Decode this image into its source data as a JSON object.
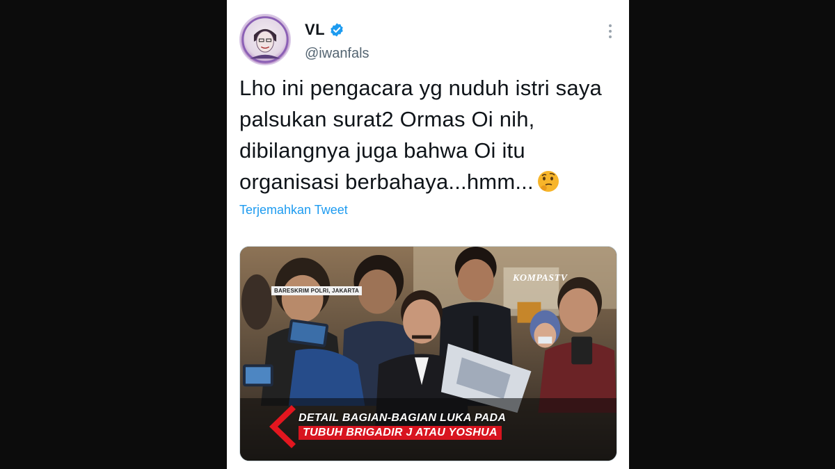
{
  "tweet": {
    "display_name": "VL",
    "handle": "@iwanfals",
    "verified": true,
    "text": "Lho ini pengacara yg nuduh istri saya palsukan surat2 Ormas Oi nih, dibilangnya juga bahwa Oi itu organisasi berbahaya...hmm...",
    "emoji": "thinking-face",
    "translate_label": "Terjemahkan Tweet"
  },
  "media": {
    "channel_logo": "KOMPASTV",
    "location_tag": "BARESKRIM POLRI, JAKARTA",
    "headline_line1": "DETAIL BAGIAN-BAGIAN LUKA PADA",
    "headline_line2": "TUBUH BRIGADIR J ATAU YOSHUA"
  },
  "colors": {
    "page_background": "#0c0c0c",
    "link": "#1d9bf0",
    "verified_badge": "#1d9bf0",
    "headline_accent": "#d8141f"
  }
}
